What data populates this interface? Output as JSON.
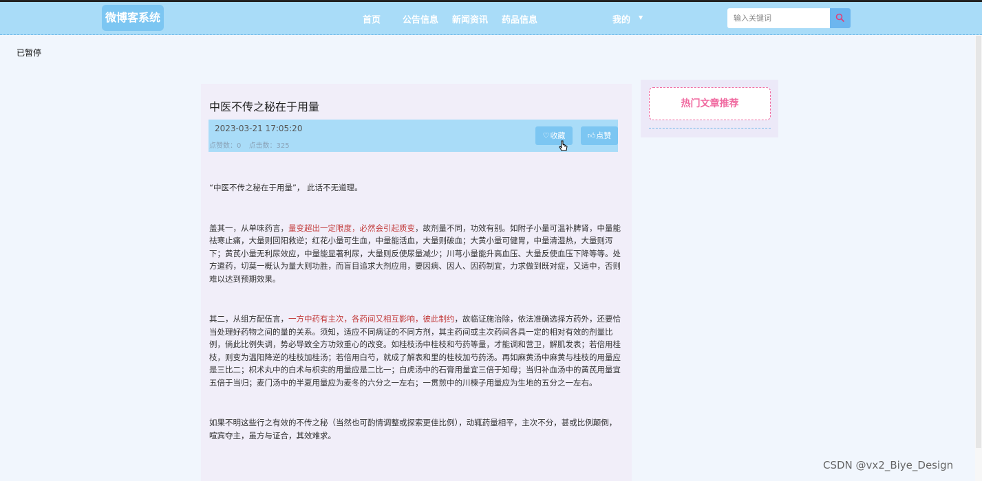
{
  "header": {
    "logo": "微博客系统",
    "nav": [
      "首页",
      "公告信息",
      "新闻资讯",
      "药品信息"
    ],
    "user_menu": "我的",
    "search": {
      "placeholder": "输入关键词"
    }
  },
  "status_text": "已暂停",
  "article": {
    "title": "中医不传之秘在于用量",
    "date": "2023-03-21 17:05:20",
    "likes_label": "点赞数：0",
    "views_label": "点击数：325",
    "favorite_label": "收藏",
    "like_label": "点赞",
    "paragraphs": [
      {
        "parts": [
          {
            "text": "“中医不传之秘在于用量”， 此话不无道理。",
            "hl": false
          }
        ]
      },
      {
        "parts": [
          {
            "text": "盖其一，从单味药言，",
            "hl": false
          },
          {
            "text": "量变超出一定限度，必然会引起质变",
            "hl": true
          },
          {
            "text": "，故剂量不同，功效有别。如附子小量可温补脾肾，中量能祛寒止痛，大量则回阳救逆；红花小量可生血，中量能活血，大量则破血；大黄小量可健胃，中量清湿热，大量则泻下；黄芪小量无利尿效应，中量能显著利尿，大量则反使尿量减少；川芎小量能升高血压、大量反使血压下降等等。处方遣药，切莫一概认为量大则功胜，而盲目追求大剂应用，要因病、因人、因药制宜，力求做到既对症，又适中，否则难以达到预期效果。",
            "hl": false
          }
        ]
      },
      {
        "parts": [
          {
            "text": "其二，从组方配伍言，",
            "hl": false
          },
          {
            "text": "一方中药有主次，各药间又相互影响，彼此制约",
            "hl": true
          },
          {
            "text": "，故临证施治除，依法准确选择方药外，还要恰当处理好药物之间的量的关系。须知，适应不同病证的不同方剂，其主药间或主次药间各具一定的相对有效的剂量比例，倘此比例失调，势必导致全方功效重心的改变。如桂枝汤中桂枝和芍药等量，才能调和营卫，解肌发表；若倍用桂枝，则变为温阳降逆的桂枝加桂汤；若倍用白芍，就成了解表和里的桂枝加芍药汤。再如麻黄汤中麻黄与桂枝的用量应是三比二；枳术丸中的白术与枳实的用量应是二比一；白虎汤中的石膏用量宜三倍于知母；当归补血汤中的黄芪用量宜五倍于当归；麦门汤中的半夏用量应为麦冬的六分之一左右；一贯煎中的川楝子用量应为生地的五分之一左右。",
            "hl": false
          }
        ]
      },
      {
        "parts": [
          {
            "text": "如果不明这些行之有效的不传之秘（当然也可酌情调整或探索更佳比例），动辄药量相平，主次不分，甚或比例颠倒，喧宾夺主，虽方与证合，其效难求。",
            "hl": false
          }
        ]
      }
    ]
  },
  "sidebar": {
    "title": "热门文章推荐"
  },
  "watermark": "CSDN @vx2_Biye_Design",
  "colors": {
    "header_bg": "#a9dcf8",
    "accent": "#7cc6f2",
    "highlight": "#c23b3b",
    "sidebar_title": "#f06aa0"
  }
}
